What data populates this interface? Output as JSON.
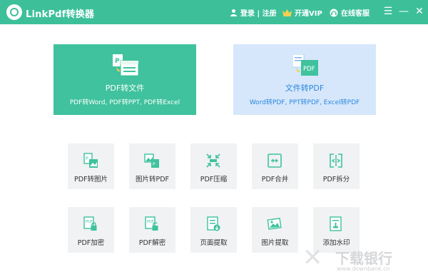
{
  "app": {
    "title": "LinkPdf转换器"
  },
  "header": {
    "login_label": "登录 | 注册",
    "vip_label": "开通VIP",
    "service_label": "在线客服",
    "menu_glyph": "☰",
    "minimize_glyph": "—",
    "close_glyph": "✕"
  },
  "cards": {
    "pdf_to_file": {
      "title": "PDF转文件",
      "subtitle": "PDF转Word, PDF转PPT, PDF转Excel",
      "icon": "pdf-to-file-icon"
    },
    "file_to_pdf": {
      "title": "文件转PDF",
      "subtitle": "Word转PDF, PPT转PDF, Excel转PDF",
      "icon": "file-to-pdf-icon",
      "badge": "PDF"
    }
  },
  "tools": [
    {
      "label": "PDF转图片",
      "icon": "pdf-to-image-icon"
    },
    {
      "label": "图片转PDF",
      "icon": "image-to-pdf-icon"
    },
    {
      "label": "PDF压缩",
      "icon": "compress-icon"
    },
    {
      "label": "PDF合并",
      "icon": "merge-icon"
    },
    {
      "label": "PDF拆分",
      "icon": "split-icon"
    },
    {
      "label": "PDF加密",
      "icon": "lock-icon"
    },
    {
      "label": "PDF解密",
      "icon": "unlock-icon"
    },
    {
      "label": "页面提取",
      "icon": "page-extract-icon"
    },
    {
      "label": "图片提取",
      "icon": "image-extract-icon"
    },
    {
      "label": "添加水印",
      "icon": "watermark-icon"
    }
  ],
  "watermark": {
    "text": "下载银行",
    "url": "www.downbank.cn"
  },
  "colors": {
    "accent_green": "#3dc09a",
    "card_blue_bg": "#d6e7fb",
    "card_blue_text": "#2b87de",
    "vip_gold": "#f6d04d"
  }
}
